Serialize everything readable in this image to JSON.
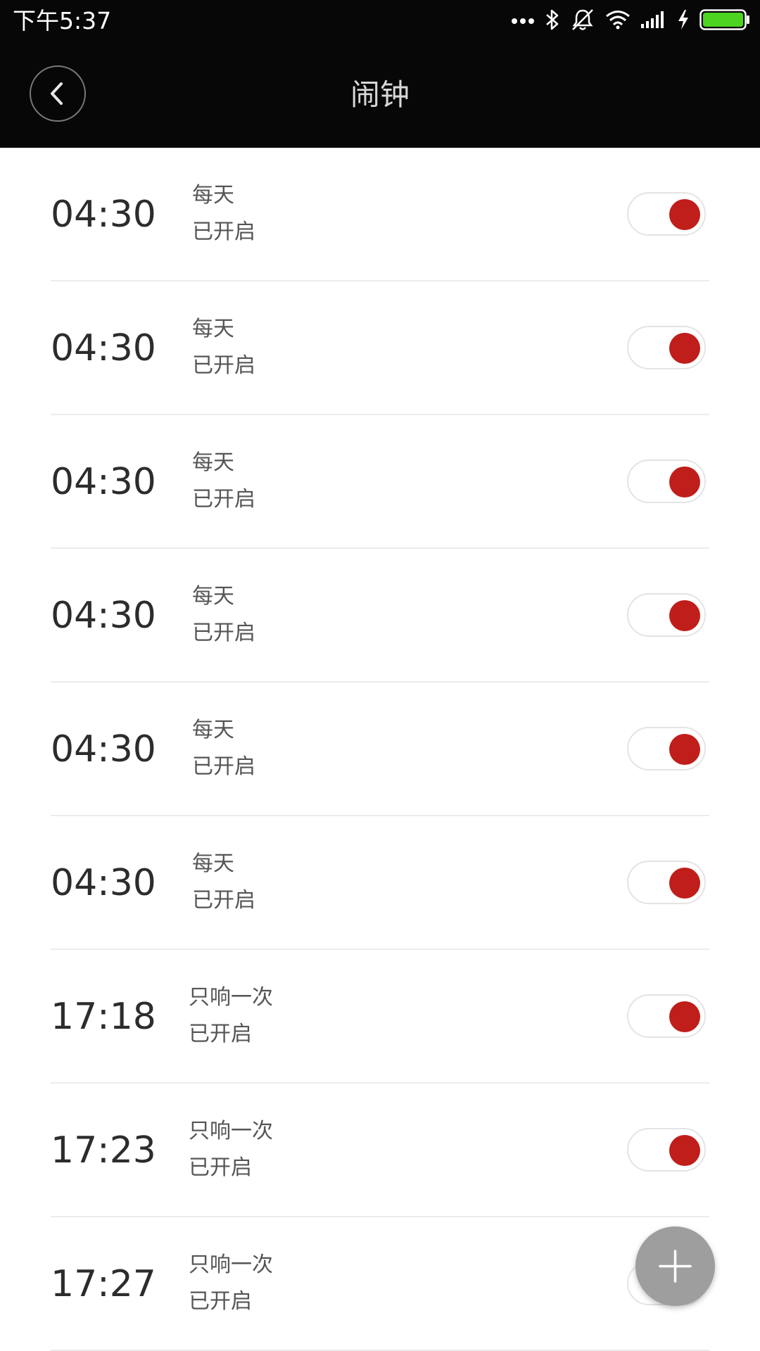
{
  "status_bar": {
    "time": "下午5:37",
    "icons": [
      "more-dots-icon",
      "bluetooth-icon",
      "vibrate-silent-icon",
      "wifi-icon",
      "cellular-signal-icon",
      "charging-bolt-icon",
      "battery-icon"
    ],
    "battery_color": "#4cd420"
  },
  "header": {
    "title": "闹钟",
    "back_icon": "back-arrow-icon"
  },
  "alarms": [
    {
      "time": "04:30",
      "repeat": "每天",
      "status": "已开启",
      "enabled": true
    },
    {
      "time": "04:30",
      "repeat": "每天",
      "status": "已开启",
      "enabled": true
    },
    {
      "time": "04:30",
      "repeat": "每天",
      "status": "已开启",
      "enabled": true
    },
    {
      "time": "04:30",
      "repeat": "每天",
      "status": "已开启",
      "enabled": true
    },
    {
      "time": "04:30",
      "repeat": "每天",
      "status": "已开启",
      "enabled": true
    },
    {
      "time": "04:30",
      "repeat": "每天",
      "status": "已开启",
      "enabled": true
    },
    {
      "time": "17:18",
      "repeat": "只响一次",
      "status": "已开启",
      "enabled": true
    },
    {
      "time": "17:23",
      "repeat": "只响一次",
      "status": "已开启",
      "enabled": true
    },
    {
      "time": "17:27",
      "repeat": "只响一次",
      "status": "已开启",
      "enabled": true
    }
  ],
  "fab": {
    "icon": "plus-icon"
  },
  "colors": {
    "header_bg": "#070707",
    "toggle_on": "#c01e1a",
    "fab_bg": "#9e9e9e"
  }
}
